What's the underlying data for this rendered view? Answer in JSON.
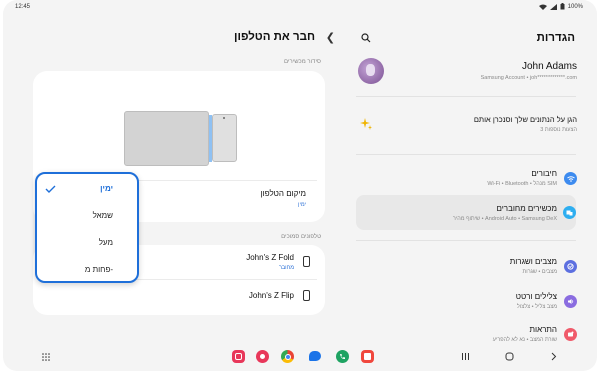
{
  "status_bar": {
    "time": "12:45",
    "battery": "100%"
  },
  "left": {
    "title": "חבר את הטלפון",
    "arrange_label": "סידור מכשירים",
    "phone_position": {
      "title": "מיקום הטלפון",
      "value": "ימין"
    },
    "nearby_label": "טלפונים סמוכים",
    "devices": [
      {
        "name": "John's Z Fold",
        "status": "מחובר"
      },
      {
        "name": "John's Z Flip",
        "status": ""
      }
    ],
    "popup_options": [
      {
        "label": "ימין",
        "selected": true
      },
      {
        "label": "שמאל",
        "selected": false
      },
      {
        "label": "מעל",
        "selected": false
      },
      {
        "label": "פחות מ-",
        "selected": false
      }
    ]
  },
  "right": {
    "title": "הגדרות",
    "profile": {
      "name": "John Adams",
      "sub": "Samsung Account • joh*************.com"
    },
    "promo": {
      "title": "הגן על הנתונים שלך וסנכרן אותם",
      "sub": "3 הצעות נוספות"
    },
    "items": [
      {
        "title": "חיבורים",
        "sub": "Wi-Fi • Bluetooth • מנהל SIM",
        "icon": "wifi-icon",
        "color": "#3d8bef"
      },
      {
        "title": "מכשירים מחוברים",
        "sub": "שיתוף מהיר • Android Auto • Samsung DeX",
        "icon": "connected-devices-icon",
        "color": "#2eaef0"
      },
      {
        "title": "מצבים ושגרות",
        "sub": "מצבים • שגרות",
        "icon": "modes-icon",
        "color": "#5c6fe0"
      },
      {
        "title": "צלילים ורטט",
        "sub": "מצב צליל • צלצול",
        "icon": "sound-icon",
        "color": "#8a6ce0"
      },
      {
        "title": "התראות",
        "sub": "שורת המצב • נא לא להפריע",
        "icon": "notifications-icon",
        "color": "#f05a6a"
      }
    ]
  },
  "colors": {
    "accent": "#1e6fd9",
    "background": "#f4f4f4"
  }
}
